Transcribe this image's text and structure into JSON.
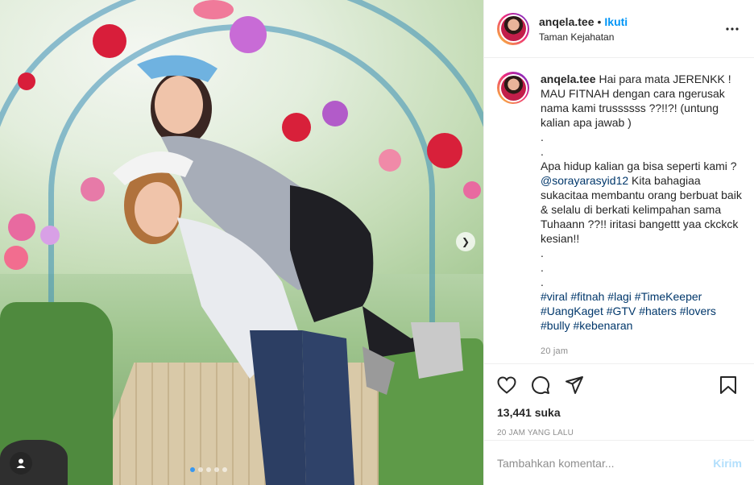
{
  "post": {
    "username": "anqela.tee",
    "separator": "•",
    "follow_label": "Ikuti",
    "location": "Taman Kejahatan"
  },
  "caption": {
    "username": "anqela.tee",
    "line1": "Hai para mata JERENKK ! MAU FITNAH dengan cara ngerusak nama kami trussssss ??!!?! (untung kalian apa jawab )",
    "dot1": ".",
    "dot2": ".",
    "line2_start": "Apa hidup kalian ga bisa seperti kami ? ",
    "mention": "@sorayarasyid12",
    "line2_end": " Kita bahagiaa sukacitaa membantu orang berbuat baik & selalu di berkati kelimpahan sama Tuhaann ??!! iritasi bangettt yaa ckckck kesian!!",
    "dot3": ".",
    "dot4": ".",
    "dot5": ".",
    "hashtags": [
      "#viral",
      "#fitnah",
      "#lagi",
      "#TimeKeeper",
      "#UangKaget",
      "#GTV",
      "#haters",
      "#lovers",
      "#bully",
      "#kebenaran"
    ],
    "time": "20 jam"
  },
  "actions": {
    "likes": "13,441 suka",
    "posted": "20 JAM YANG LALU"
  },
  "comment_box": {
    "placeholder": "Tambahkan komentar...",
    "send_label": "Kirim"
  },
  "icons": {
    "like": "heart-icon",
    "comment": "comment-icon",
    "share": "send-icon",
    "save": "bookmark-icon",
    "more": "more-horizontal-icon",
    "tag": "user-tag-icon",
    "next": "chevron-right-icon"
  },
  "colors": {
    "follow": "#0095f6",
    "hashtag": "#00376b",
    "send_disabled": "#b2dffc"
  }
}
